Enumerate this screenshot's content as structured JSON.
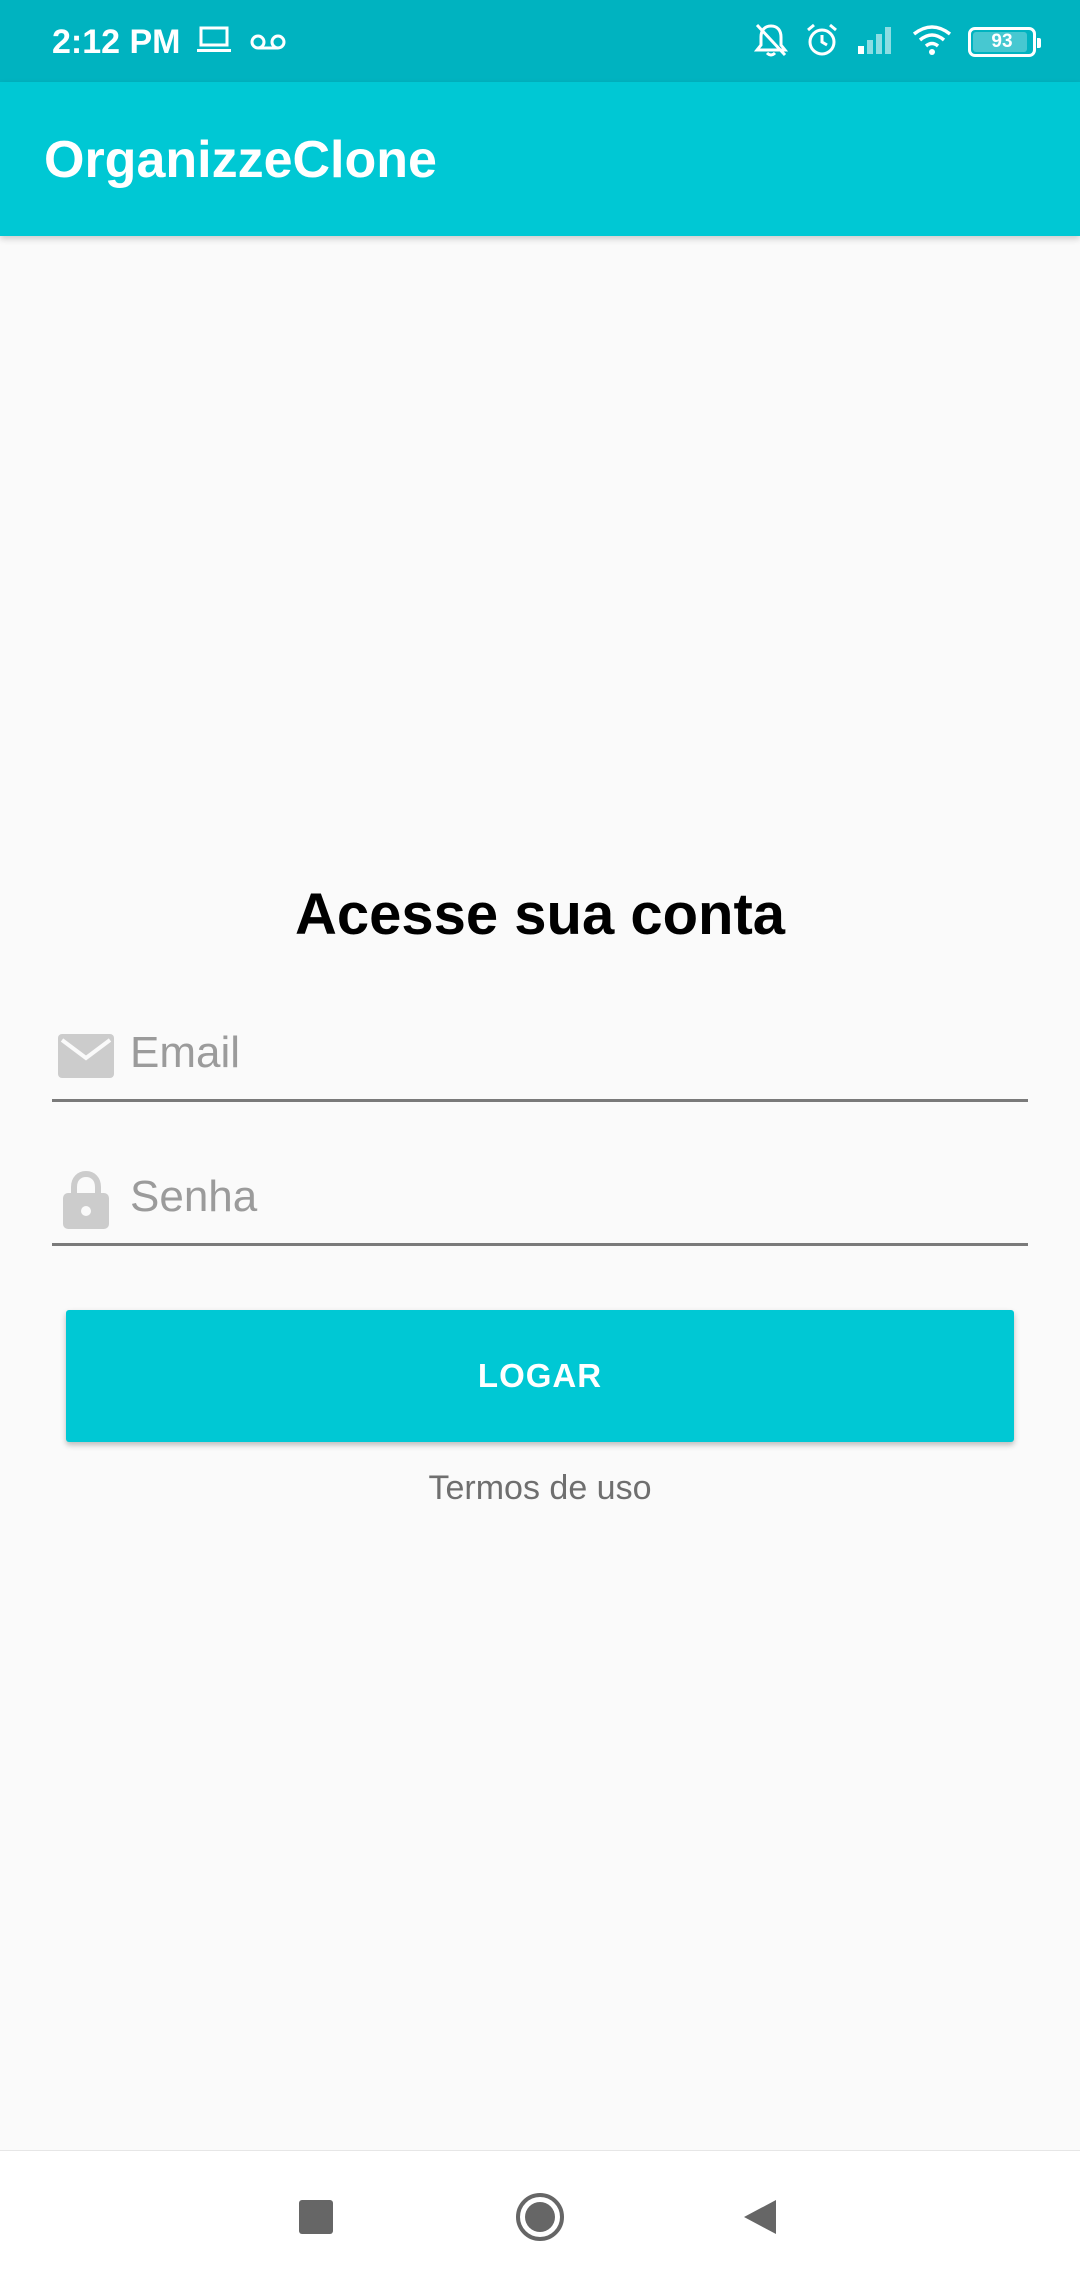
{
  "status_bar": {
    "time": "2:12 PM",
    "battery_level": "93",
    "icons": [
      "laptop-icon",
      "voicemail-icon",
      "bell-off-icon",
      "alarm-icon",
      "signal-icon",
      "wifi-icon",
      "battery-icon"
    ]
  },
  "app_bar": {
    "title": "OrganizzeClone",
    "color": "#00c8d4"
  },
  "login": {
    "heading": "Acesse sua conta",
    "email": {
      "placeholder": "Email",
      "value": "",
      "icon": "email-icon"
    },
    "password": {
      "placeholder": "Senha",
      "value": "",
      "icon": "lock-icon"
    },
    "login_button_label": "LOGAR",
    "terms_link": "Termos de uso"
  },
  "nav_bar": {
    "buttons": [
      "recents-icon",
      "home-icon",
      "back-icon"
    ]
  },
  "colors": {
    "status_bar": "#00b3c0",
    "accent": "#00c8d4",
    "background": "#fafafa"
  }
}
